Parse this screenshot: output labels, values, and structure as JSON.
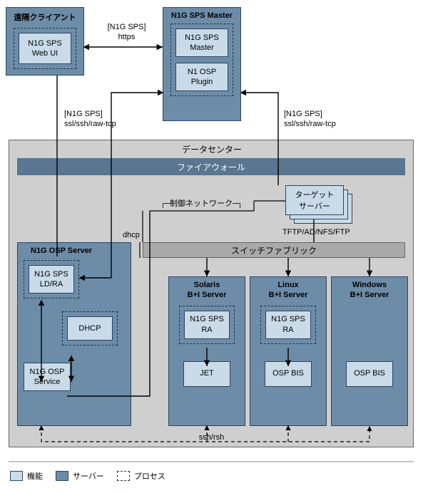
{
  "remote_client": {
    "title": "遠隔クライアント",
    "webui": "N1G SPS\nWeb UI"
  },
  "sps_master": {
    "title": "N1G SPS Master",
    "master": "N1G SPS\nMaster",
    "plugin": "N1 OSP\nPlugin"
  },
  "conn": {
    "https": "[N1G SPS]\nhttps",
    "ssl_left": "[N1G SPS]\nssl/ssh/raw-tcp",
    "ssl_right": "[N1G SPS]\nssl/ssh/raw-tcp",
    "dhcp": "dhcp",
    "ctrl_net": "制御ネットワーク",
    "tftp": "TFTP/AD/NFS/FTP",
    "sshrsh": "ssh/rsh"
  },
  "data_center": {
    "title": "データセンター",
    "firewall": "ファイアウォール",
    "switch": "スイッチファブリック",
    "target": "ターゲット\nサーバー"
  },
  "osp_server": {
    "title": "N1G OSP Server",
    "ldra": "N1G SPS\nLD/RA",
    "dhcp": "DHCP",
    "service": "N1G OSP\nService"
  },
  "solaris": {
    "title": "Solaris\nB+I Server",
    "ra": "N1G SPS\nRA",
    "jet": "JET"
  },
  "linux": {
    "title": "Linux\nB+I Server",
    "ra": "N1G SPS\nRA",
    "bis": "OSP BIS"
  },
  "windows": {
    "title": "Windows\nB+I Server",
    "bis": "OSP BIS"
  },
  "legend": {
    "func": "機能",
    "server": "サーバー",
    "process": "プロセス"
  }
}
